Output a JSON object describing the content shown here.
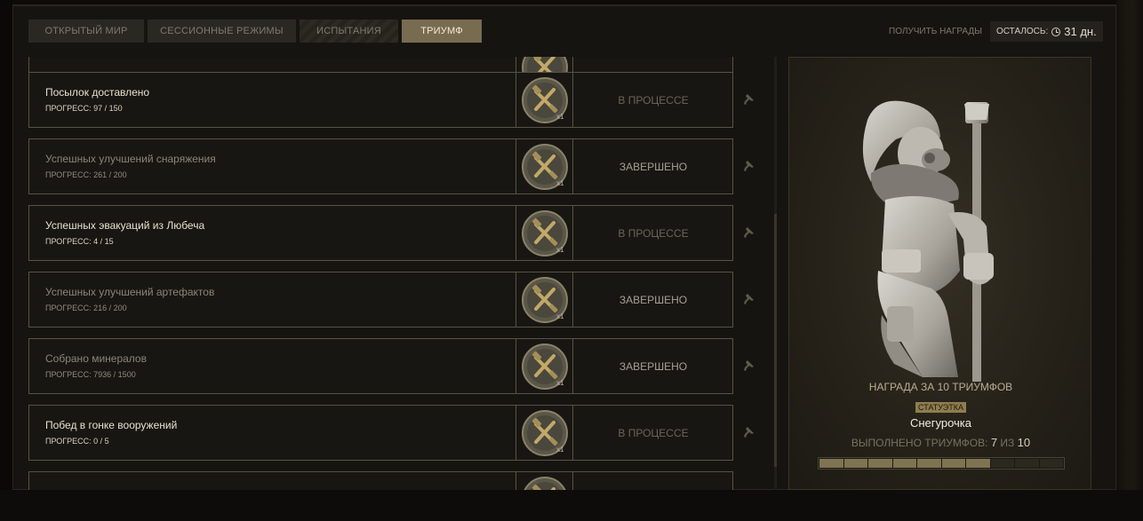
{
  "tabs": [
    {
      "label": "ОТКРЫТЫЙ МИР",
      "active": false
    },
    {
      "label": "СЕССИОННЫЕ РЕЖИМЫ",
      "active": false
    },
    {
      "label": "ИСПЫТАНИЯ",
      "active": false
    },
    {
      "label": "ТРИУМФ",
      "active": true
    }
  ],
  "header": {
    "get_rewards": "ПОЛУЧИТЬ НАГРАДЫ",
    "remaining_label": "ОСТАЛОСЬ:",
    "remaining_value": "31 дн."
  },
  "tasks": [
    {
      "title": "",
      "progress": "",
      "reward_qty": "",
      "status": "",
      "done": false
    },
    {
      "title": "Посылок доставлено",
      "progress": "ПРОГРЕСС: 97 / 150",
      "reward_qty": "x1",
      "status": "В ПРОЦЕССЕ",
      "done": false
    },
    {
      "title": "Успешных улучшений снаряжения",
      "progress": "ПРОГРЕСС: 261 / 200",
      "reward_qty": "x1",
      "status": "ЗАВЕРШЕНО",
      "done": true
    },
    {
      "title": "Успешных эвакуаций из Любеча",
      "progress": "ПРОГРЕСС: 4 / 15",
      "reward_qty": "x1",
      "status": "В ПРОЦЕССЕ",
      "done": false
    },
    {
      "title": "Успешных улучшений артефактов",
      "progress": "ПРОГРЕСС: 216 / 200",
      "reward_qty": "x1",
      "status": "ЗАВЕРШЕНО",
      "done": true
    },
    {
      "title": "Собрано минералов",
      "progress": "ПРОГРЕСС: 7936 / 1500",
      "reward_qty": "x1",
      "status": "ЗАВЕРШЕНО",
      "done": true
    },
    {
      "title": "Побед в гонке вооружений",
      "progress": "ПРОГРЕСС: 0 / 5",
      "reward_qty": "x1",
      "status": "В ПРОЦЕССЕ",
      "done": false
    },
    {
      "title": "",
      "progress": "",
      "reward_qty": "",
      "status": "",
      "done": false
    }
  ],
  "reward": {
    "title": "НАГРАДА ЗА 10 ТРИУМФОВ",
    "type_badge": "СТАТУЭТКА",
    "name": "Снегурочка",
    "count_label": "ВЫПОЛНЕНО ТРИУМФОВ:",
    "count_done": "7",
    "count_sep": "ИЗ",
    "count_total": "10",
    "segments_done": 7,
    "segments_total": 10
  },
  "icons": {
    "reward_coin": "crossed-tools-coin-icon",
    "pin": "pin-icon",
    "clock": "clock-icon"
  },
  "colors": {
    "accent": "#786c50",
    "progress_fill": "#7f7452",
    "badge": "#8f7d4e"
  }
}
